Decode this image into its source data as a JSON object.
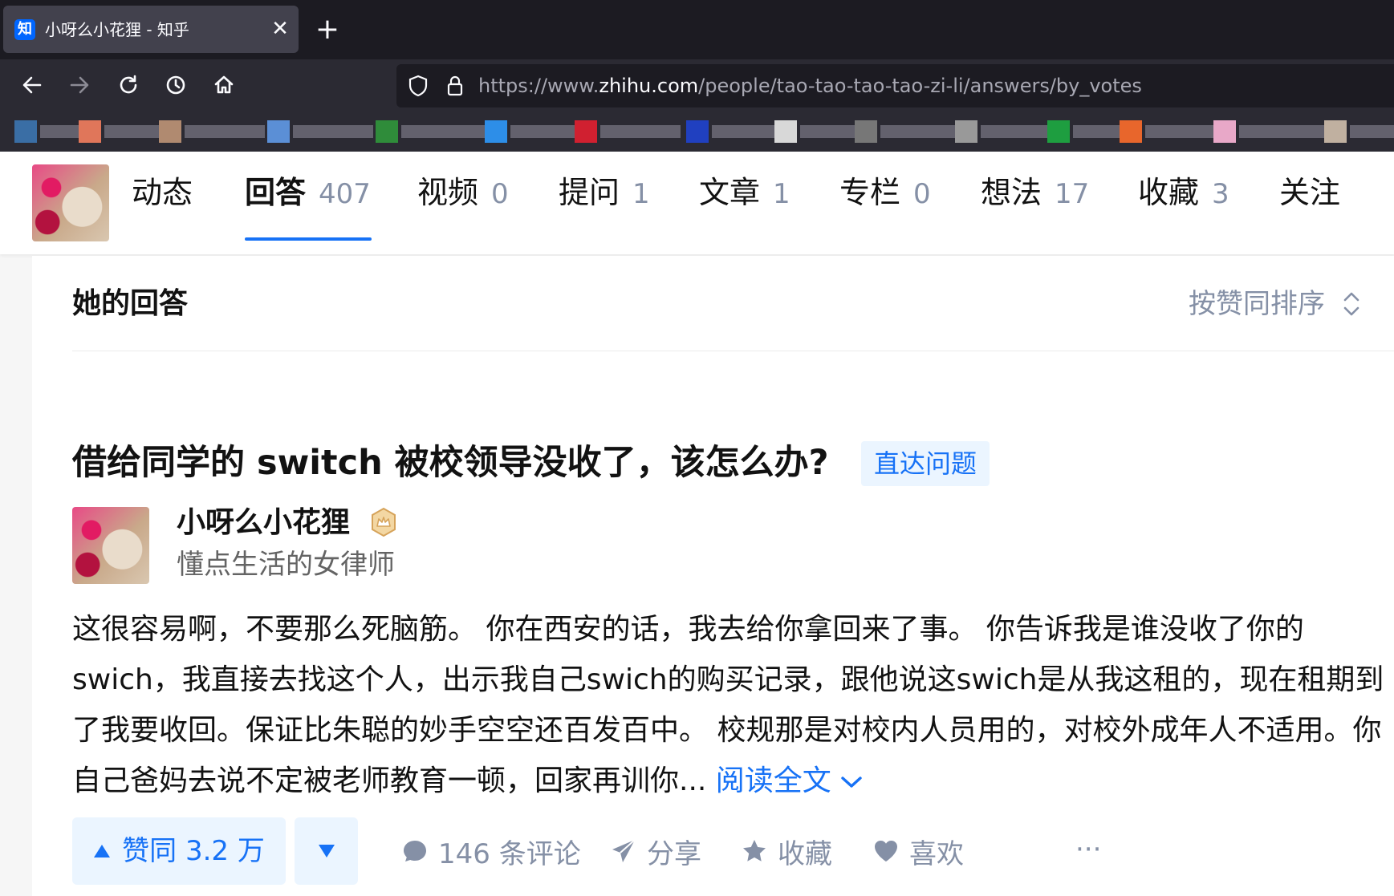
{
  "browser": {
    "tab_title": "小呀么小花狸 - 知乎",
    "tab_favicon": "知",
    "url_prefix": "https://www.",
    "url_domain": "zhihu.com",
    "url_path": "/people/tao-tao-tao-tao-zi-li/answers/by_votes"
  },
  "profile_nav": {
    "tabs": [
      {
        "label": "动态",
        "count": ""
      },
      {
        "label": "回答",
        "count": "407"
      },
      {
        "label": "视频",
        "count": "0"
      },
      {
        "label": "提问",
        "count": "1"
      },
      {
        "label": "文章",
        "count": "1"
      },
      {
        "label": "专栏",
        "count": "0"
      },
      {
        "label": "想法",
        "count": "17"
      },
      {
        "label": "收藏",
        "count": "3"
      },
      {
        "label": "关注",
        "count": ""
      }
    ],
    "active_tab": "回答"
  },
  "answers": {
    "heading": "她的回答",
    "sort_label": "按赞同排序"
  },
  "answer": {
    "question": "借给同学的 switch 被校领导没收了，该怎么办?",
    "goto_question": "直达问题",
    "author_name": "小呀么小花狸",
    "author_bio": "懂点生活的女律师",
    "excerpt": "这很容易啊，不要那么死脑筋。 你在西安的话，我去给你拿回来了事。 你告诉我是谁没收了你的swich，我直接去找这个人，出示我自己swich的购买记录，跟他说这swich是从我这租的，现在租期到了我要收回。保证比朱聪的妙手空空还百发百中。 校规那是对校内人员用的，对校外成年人不适用。你自己爸妈去说不定被老师教育一顿，回家再训你...",
    "read_more": "阅读全文",
    "vote_up": "赞同 3.2 万",
    "comments": "146 条评论",
    "share": "分享",
    "collect": "收藏",
    "like": "喜欢",
    "more": "···"
  }
}
